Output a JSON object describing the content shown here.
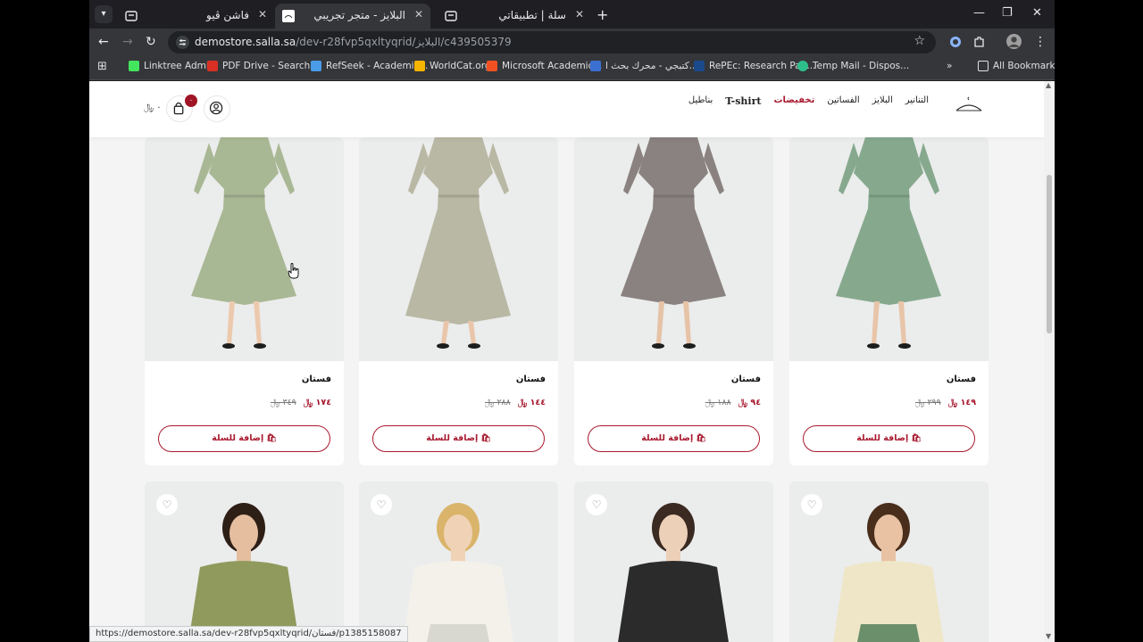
{
  "browser": {
    "tabs": [
      {
        "title": "فاشن ڤيو",
        "active": false
      },
      {
        "title": "البلايز - متجر تجريبي",
        "active": true
      },
      {
        "title": "سلة | تطبيقاتي",
        "active": false
      }
    ],
    "new_tab_label": "+",
    "url_host": "demostore.salla.sa",
    "url_path": "/dev-r28fvp5qxltyqrid/البلايز/c439505379",
    "bookmarks": [
      {
        "label": "Linktree Admin",
        "color": "#43e55e"
      },
      {
        "label": "PDF Drive - Search...",
        "color": "#d93025"
      },
      {
        "label": "RefSeek - Academic...",
        "color": "#4a9be8"
      },
      {
        "label": "WorldCat.org",
        "color": "#f4b400"
      },
      {
        "label": "Microsoft Academic...",
        "color": "#f25022"
      },
      {
        "label": "كتبجي - محرك بحث ا...",
        "color": "#3b6fd1"
      },
      {
        "label": "RePEc: Research Pap...",
        "color": "#1a4a8a"
      },
      {
        "label": "Temp Mail - Dispos...",
        "color": "#2dbf8a"
      }
    ],
    "all_bookmarks_label": "All Bookmarks",
    "status_url": "https://demostore.salla.sa/dev-r28fvp5qxltyqrid/فستان/p1385158087"
  },
  "store": {
    "nav": [
      {
        "label": "بناطيل",
        "style": "normal"
      },
      {
        "label": "T-shirt",
        "style": "tshirt"
      },
      {
        "label": "تخفيضات",
        "style": "sale"
      },
      {
        "label": "الفساتين",
        "style": "normal"
      },
      {
        "label": "البلايز",
        "style": "normal"
      },
      {
        "label": "التنانير",
        "style": "normal"
      }
    ],
    "cart_count": "٠",
    "cart_total": "٠ ﷼",
    "accent_color": "#a8192e"
  },
  "products": [
    {
      "name": "فستان",
      "price": "١٤٩ ﷼",
      "old_price": "٢٩٩ ﷼",
      "button": "إضافة للسلة",
      "dress_color": "#86a98e",
      "skin": "#e8c4a8"
    },
    {
      "name": "فستان",
      "price": "٩٤ ﷼",
      "old_price": "١٨٨ ﷼",
      "button": "إضافة للسلة",
      "dress_color": "#8a8280",
      "skin": "#e6c2a6"
    },
    {
      "name": "فستان",
      "price": "١٤٤ ﷼",
      "old_price": "٢٨٨ ﷼",
      "button": "إضافة للسلة",
      "dress_color": "#b9b8a4",
      "skin": "#e9c6aa"
    },
    {
      "name": "فستان",
      "price": "١٧٤ ﷼",
      "old_price": "٣٤٩ ﷼",
      "button": "إضافة للسلة",
      "dress_color": "#a9b894",
      "skin": "#ecc9ad"
    }
  ],
  "products_row2": [
    {
      "top_color": "#efe6c8",
      "bottom_color": "#6b8f6b",
      "skin": "#e8c2a2",
      "hair": "#4a2e1c"
    },
    {
      "top_color": "#2b2b2b",
      "bottom_color": "#2b2b2b",
      "skin": "#edd0b8",
      "hair": "#3a2a22"
    },
    {
      "top_color": "#f4f1ea",
      "bottom_color": "#d8d8d0",
      "skin": "#f0d2b6",
      "hair": "#d9b46a"
    },
    {
      "top_color": "#8f9a5c",
      "bottom_color": "#8f9a5c",
      "skin": "#e5bea0",
      "hair": "#2d1e16"
    }
  ]
}
